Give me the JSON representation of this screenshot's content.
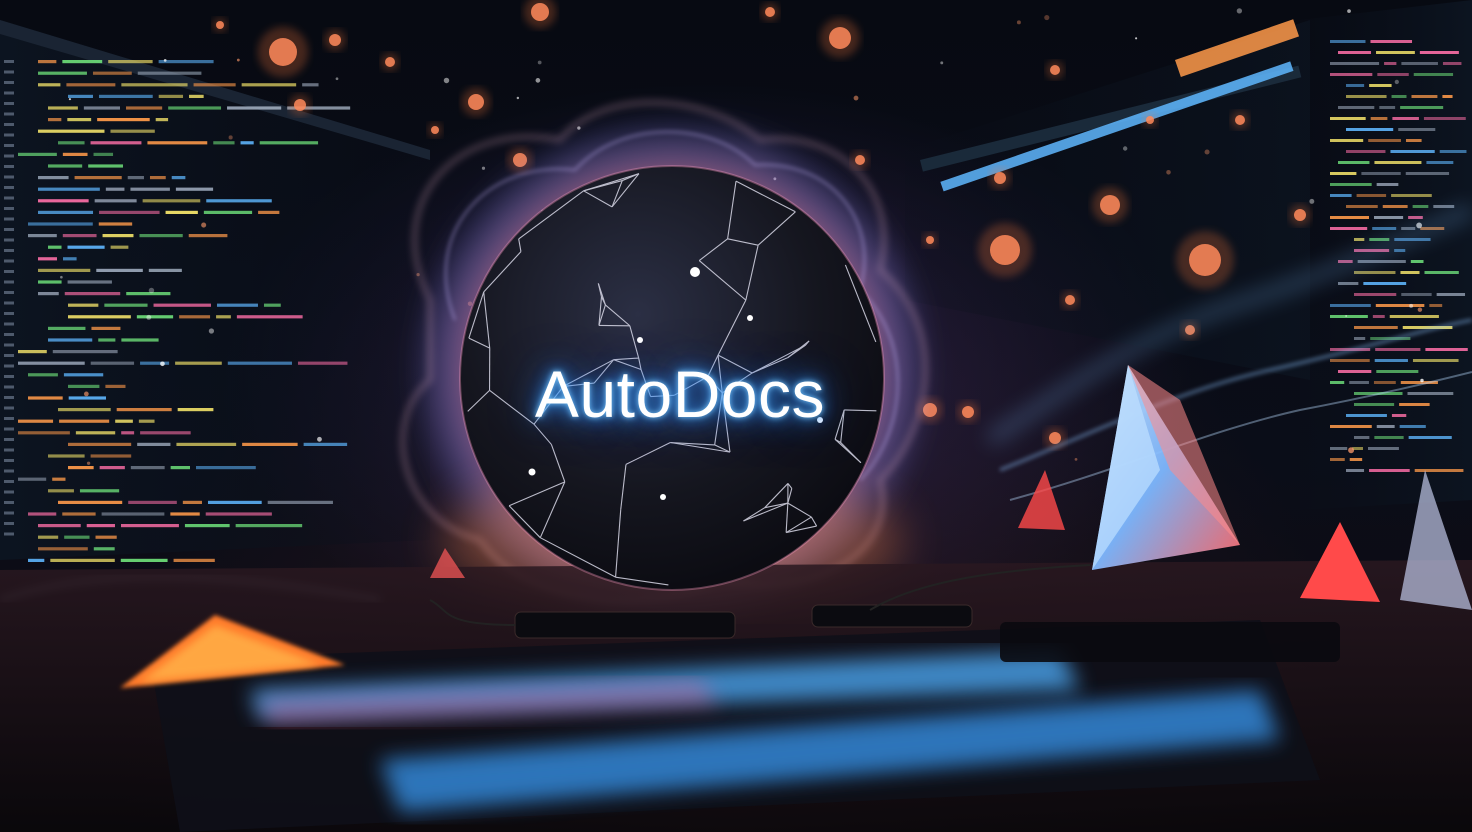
{
  "title": "AutoDocs",
  "colors": {
    "background": "#05070d",
    "sphere": "#16161f",
    "glow_blue": "#3aa0ff",
    "glow_orange": "#ff7a3a",
    "smoke_pink": "#ff9fc4",
    "smoke_blue": "#8fc4ff",
    "code_green": "#6ee07a",
    "code_orange": "#ff9a4a",
    "code_yellow": "#f3e36a",
    "code_blue": "#5fb7ff",
    "code_pink": "#ff6fa8",
    "crystal_red": "#ff5a5a",
    "crystal_blue": "#9fd4ff"
  },
  "icons": [
    "network-sphere-icon",
    "crystal-pyramid-icon",
    "code-screen-icon"
  ]
}
